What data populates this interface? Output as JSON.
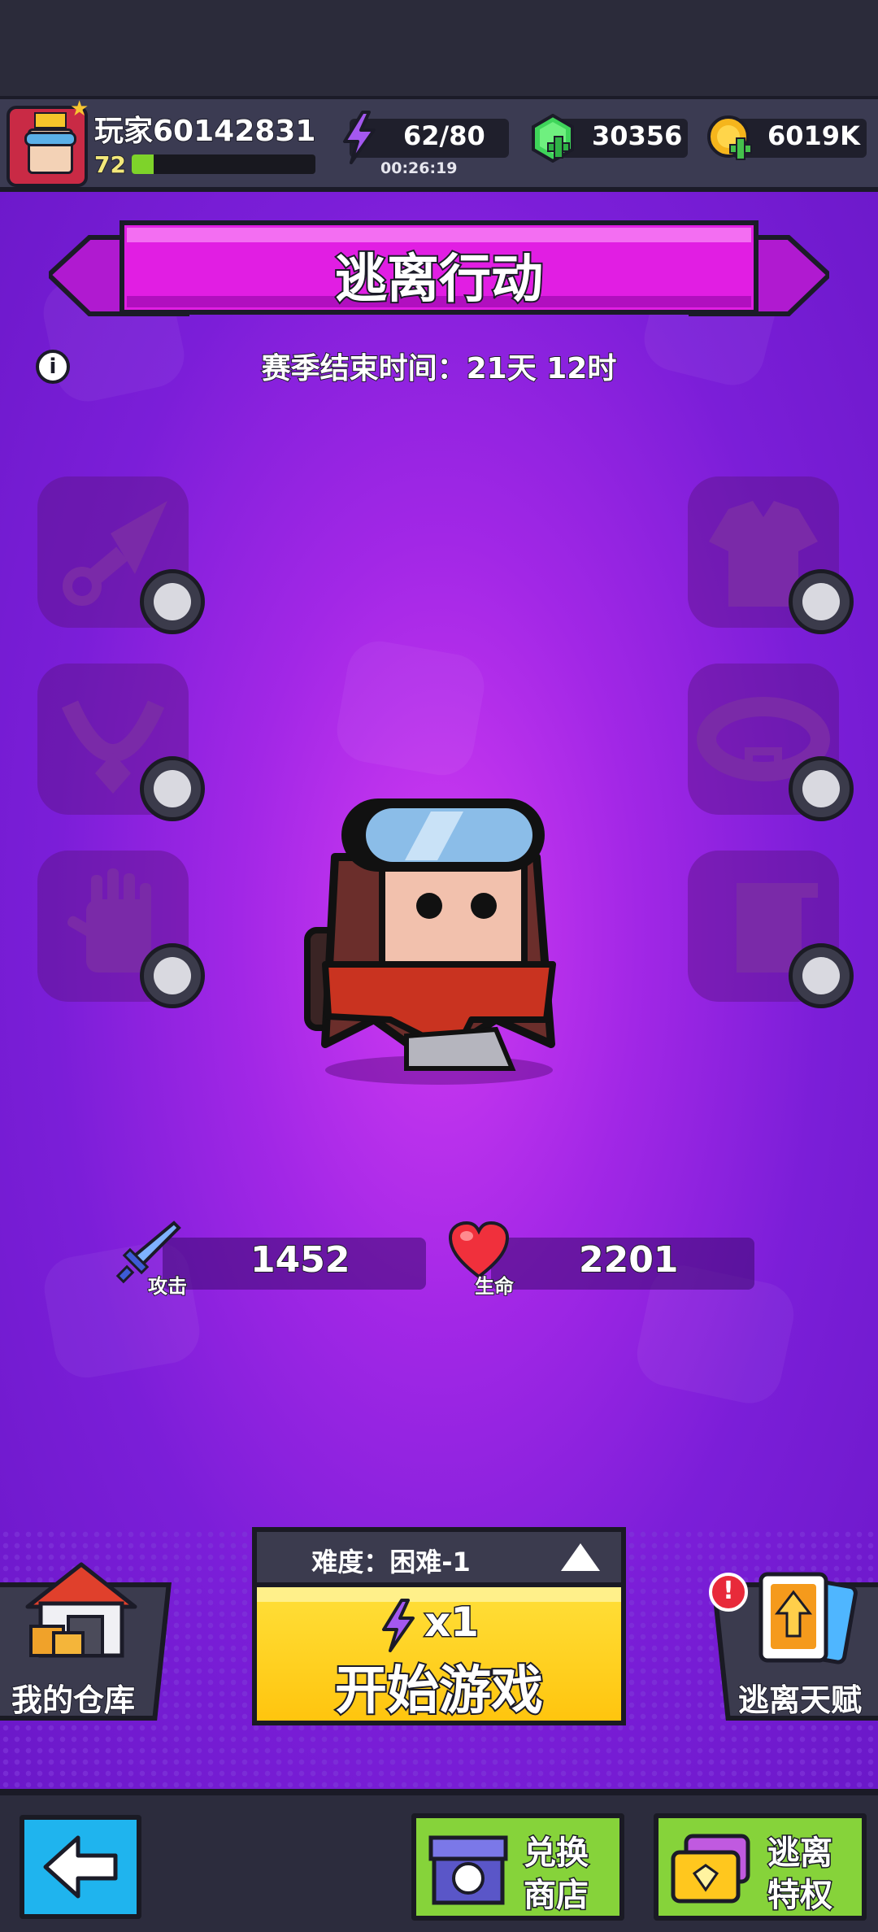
{
  "player": {
    "name": "玩家60142831",
    "level": "72",
    "xp_progress": 0.12
  },
  "resources": {
    "energy": "62/80",
    "energy_timer": "00:26:19",
    "gems": "30356",
    "gold": "6019K"
  },
  "event": {
    "title": "逃离行动",
    "season_end": "赛季结束时间：21天 12时"
  },
  "stats": {
    "attack_label": "攻击",
    "attack_value": "1452",
    "hp_label": "生命",
    "hp_value": "2201"
  },
  "play": {
    "difficulty": "难度：困难-1",
    "cost": "x1",
    "start_label": "开始游戏"
  },
  "side_buttons": {
    "warehouse": "我的仓库",
    "talent": "逃离天赋"
  },
  "nav": {
    "shop": [
      "兑换",
      "商店"
    ],
    "privilege": [
      "逃离",
      "特权"
    ]
  },
  "colors": {
    "accent_purple": "#a227e6",
    "banner_magenta": "#e11ee3",
    "start_yellow": "#ffd21e",
    "nav_green": "#86d33a",
    "back_blue": "#1fb4ee"
  }
}
